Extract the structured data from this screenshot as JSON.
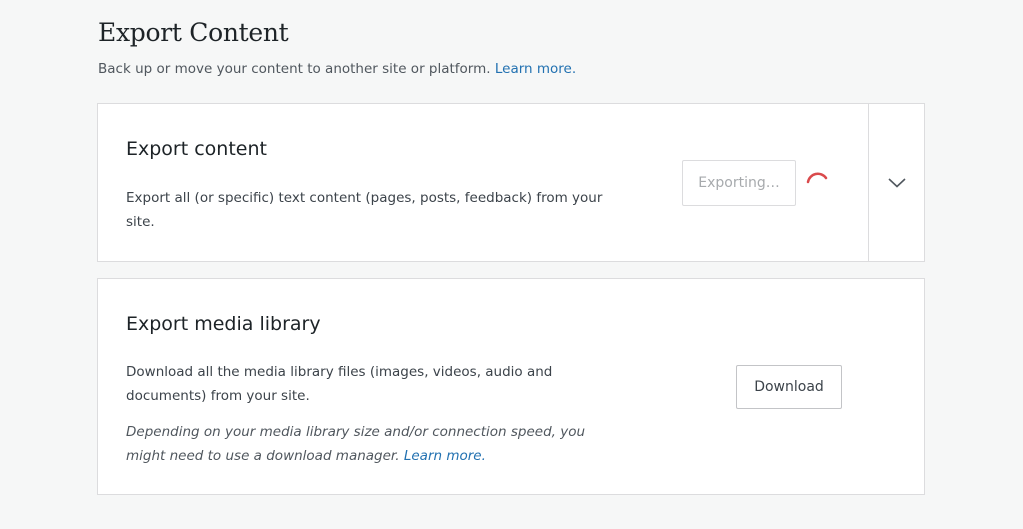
{
  "header": {
    "title": "Export Content",
    "subtitle": "Back up or move your content to another site or platform.",
    "subtitle_link": "Learn more."
  },
  "export_content": {
    "title": "Export content",
    "description": "Export all (or specific) text content (pages, posts, feedback) from your site.",
    "button_label": "Exporting…",
    "expand_icon": "chevron-down-icon",
    "spinner_color": "#d63638"
  },
  "export_media": {
    "title": "Export media library",
    "description": "Download all the media library files (images, videos, audio and documents) from your site.",
    "note": "Depending on your media library size and/or connection speed, you might need to use a download manager.",
    "note_link": "Learn more.",
    "button_label": "Download"
  },
  "colors": {
    "link": "#2271b1",
    "background": "#f6f7f7"
  }
}
